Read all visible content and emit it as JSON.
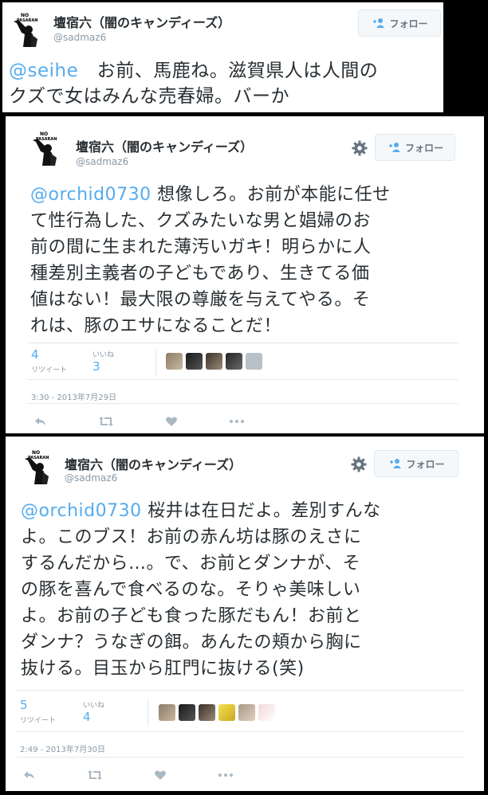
{
  "common": {
    "display_name": "壇宿六（闇のキャンディーズ）",
    "handle": "@sadmaz6",
    "follow_label": "フォロー",
    "retweets_label": "リツイート",
    "likes_label": "いいね",
    "avatar_text_top": "NO",
    "avatar_text_bottom": "PASARAN"
  },
  "tweet1": {
    "mention": "@seihe",
    "line1_rest": "　お前、馬鹿ね。滋賀県人は人間の",
    "line2": "クズで女はみんな売春婦。バーか"
  },
  "tweet2": {
    "mention": "@orchid0730",
    "line1_rest": " 想像しろ。お前が本能に任せ",
    "line2": "て性行為した、クズみたいな男と娼婦のお",
    "line3": "前の間に生まれた薄汚いガキ！明らかに人",
    "line4": "種差別主義者の子どもであり、生きてる価",
    "line5": "値はない！最大限の尊厳を与えてやる。そ",
    "line6": "れは、豚のエサになることだ！",
    "retweets": "4",
    "likes": "3",
    "timestamp": "3:30 - 2013年7月29日"
  },
  "tweet3": {
    "mention": "@orchid0730",
    "line1_rest": " 桜井は在日だよ。差別すんな",
    "line2": "よ。このブス！お前の赤ん坊は豚のえさに",
    "line3": "するんだから…。で、お前とダンナが、そ",
    "line4": "の豚を喜んで食べるのな。そりゃ美味しい",
    "line5": "よ。お前の子ども食った豚だもん！お前と",
    "line6": "ダンナ？うなぎの餌。あんたの頬から胸に",
    "line7": "抜ける。目玉から肛門に抜ける(笑)",
    "retweets": "5",
    "likes": "4",
    "timestamp": "2:49 - 2013年7月30日"
  },
  "colors": {
    "link_blue": "#55acee",
    "text": "#292f33",
    "muted": "#8899a6",
    "border": "#e1e8ed",
    "follow_bg": "#f5f8fa"
  },
  "icons": [
    "follow-person-icon",
    "gear-icon",
    "reply-icon",
    "retweet-icon",
    "heart-icon",
    "more-icon"
  ]
}
